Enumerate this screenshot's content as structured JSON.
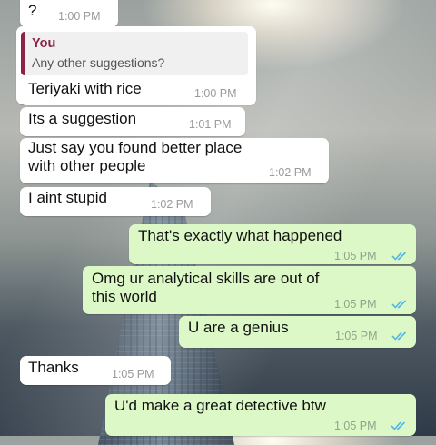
{
  "messages": [
    {
      "direction": "in",
      "text": "?",
      "time": "1:00 PM"
    },
    {
      "direction": "in",
      "reply_author": "You",
      "reply_text": "Any other suggestions?",
      "text": "Teriyaki with rice",
      "time": "1:00 PM"
    },
    {
      "direction": "in",
      "text": "Its a suggestion",
      "time": "1:01 PM"
    },
    {
      "direction": "in",
      "text_line1": "Just say you found better place",
      "text_line2": "with other people",
      "time": "1:02 PM"
    },
    {
      "direction": "in",
      "text": "I aint stupid",
      "time": "1:02 PM"
    },
    {
      "direction": "out",
      "text": "That's exactly what happened",
      "time": "1:05 PM",
      "status": "read"
    },
    {
      "direction": "out",
      "text_line1": "Omg ur analytical skills are out of",
      "text_line2": "this world",
      "time": "1:05 PM",
      "status": "read"
    },
    {
      "direction": "out",
      "text": "U are a genius",
      "time": "1:05 PM",
      "status": "read"
    },
    {
      "direction": "in",
      "text": "Thanks",
      "time": "1:05 PM"
    },
    {
      "direction": "out",
      "text": "U'd make a great detective btw",
      "time": "1:05 PM",
      "status": "read"
    }
  ],
  "colors": {
    "incoming_bubble": "#ffffff",
    "outgoing_bubble": "#dcf8c6",
    "read_ticks": "#4fb6ec",
    "reply_accent": "#8a2346"
  },
  "icons": {
    "read_status": "double-check-icon"
  }
}
